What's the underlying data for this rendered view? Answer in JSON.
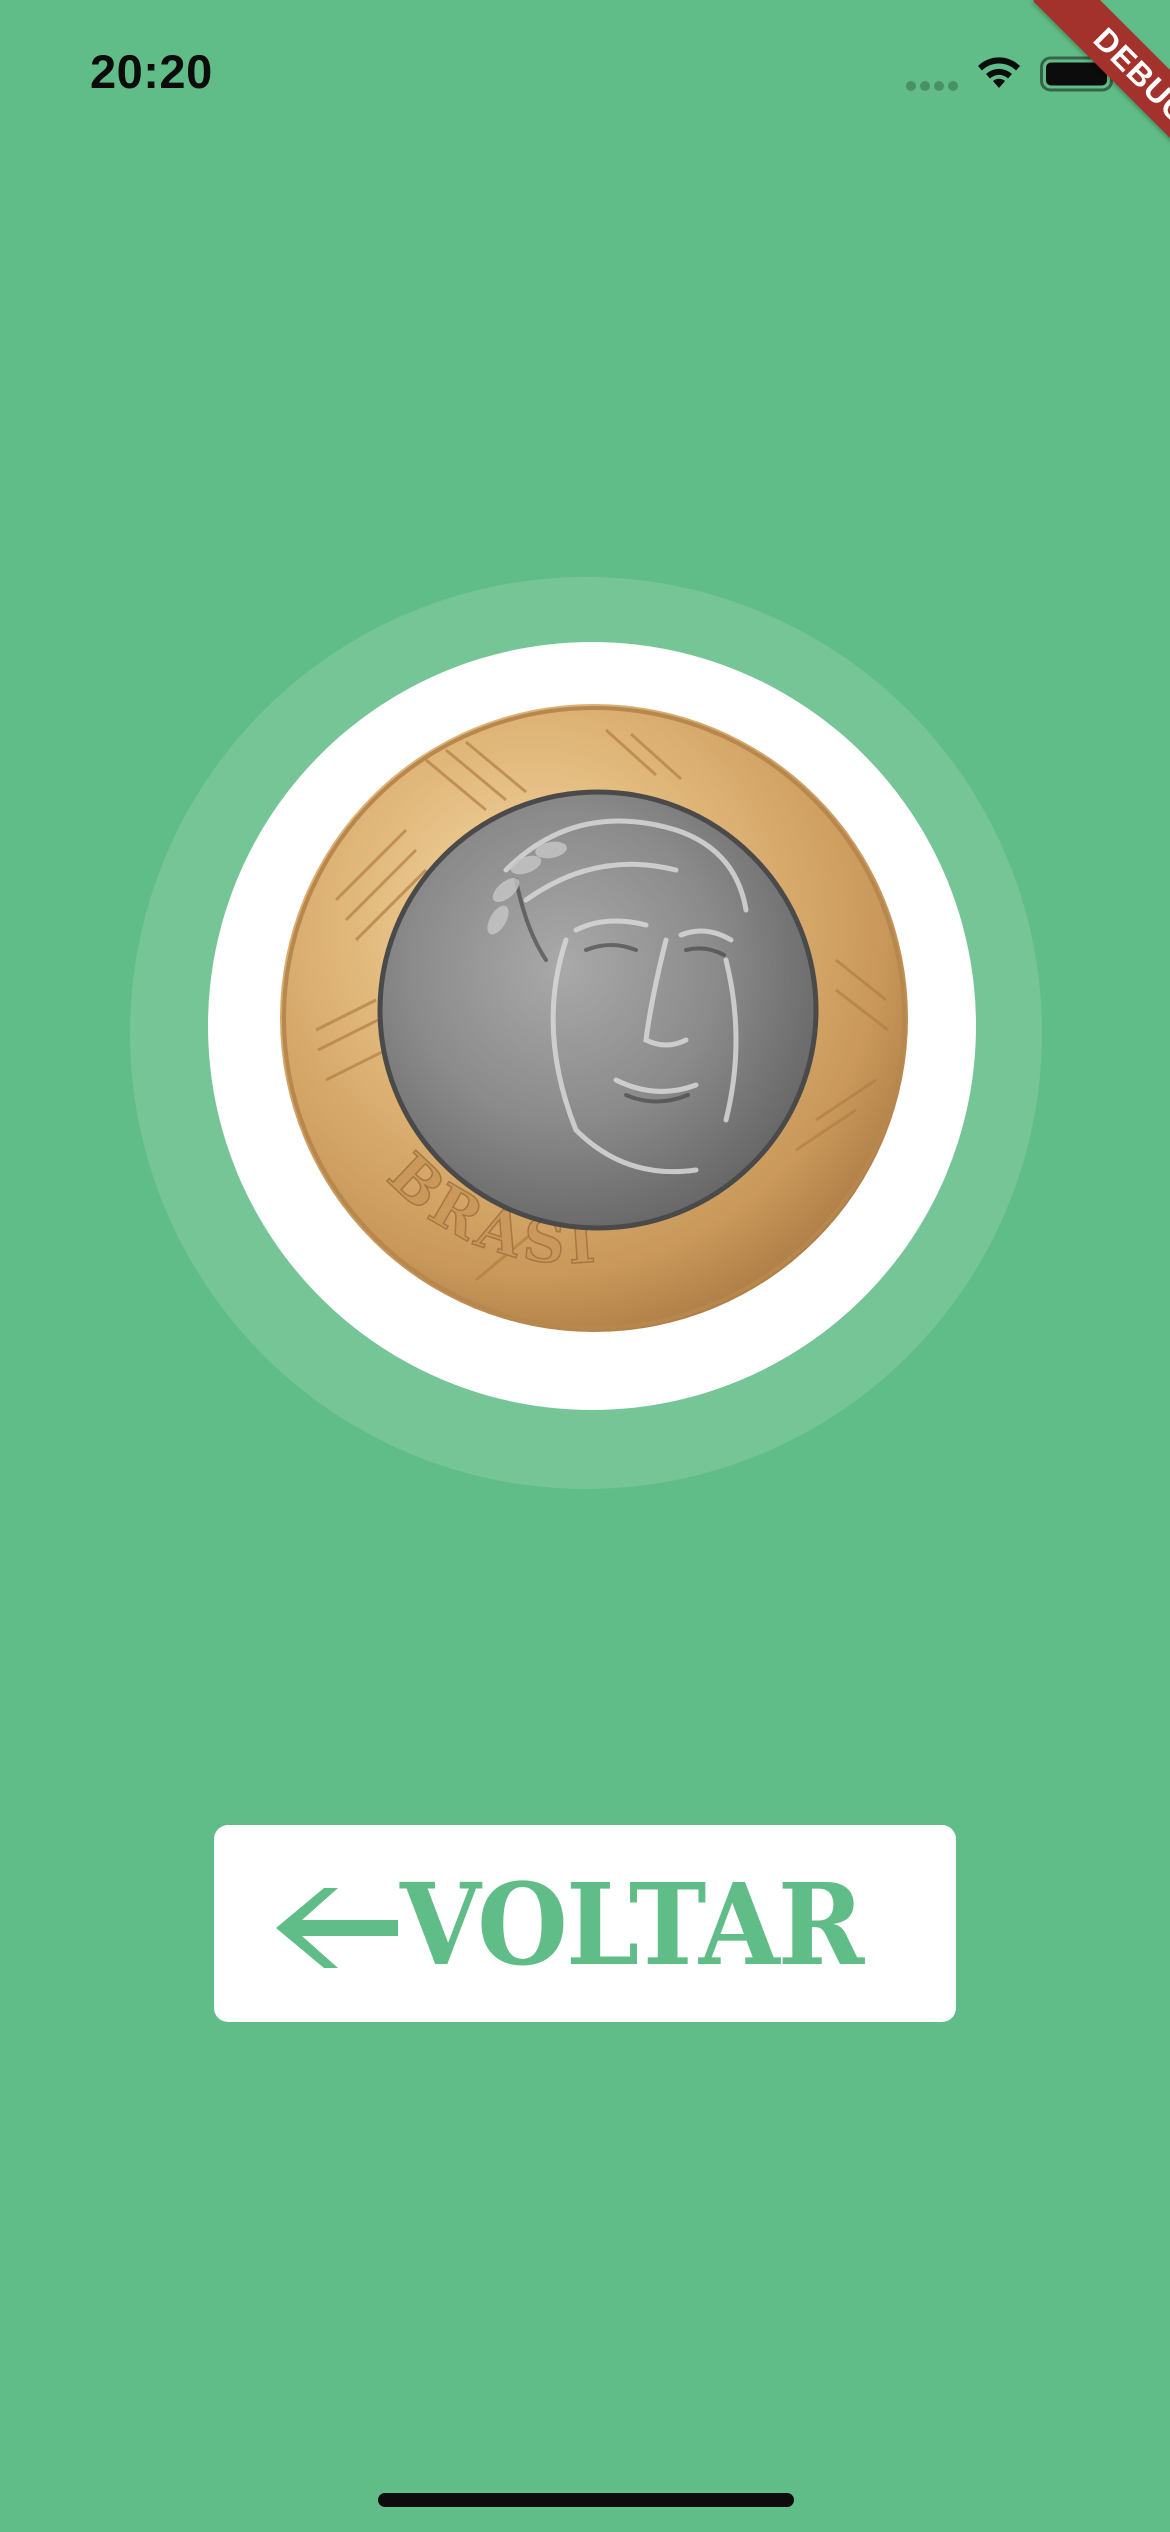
{
  "status_bar": {
    "time": "20:20",
    "icons": [
      "cellular-signal-icon",
      "wifi-icon",
      "battery-icon"
    ]
  },
  "debug_banner": {
    "label": "DEBUG"
  },
  "coin": {
    "icon": "brazil-one-real-coin",
    "inscription": "BRASIL"
  },
  "back_button": {
    "label": "VOLTAR",
    "icon": "arrow-left-icon"
  },
  "colors": {
    "background": "#61bd87",
    "accent": "#61bd87",
    "ribbon": "#a3322c",
    "surface": "#ffffff"
  }
}
